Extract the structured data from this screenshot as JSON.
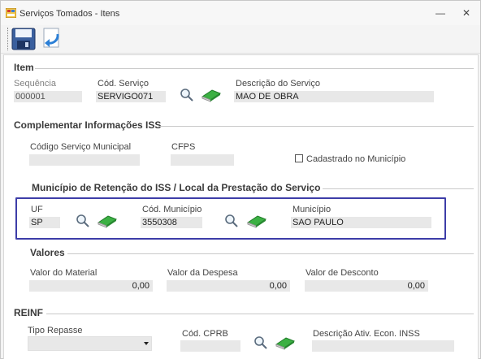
{
  "window": {
    "title": "Serviços Tomados - Itens",
    "minimize": "—",
    "close": "✕"
  },
  "toolbar": {
    "save_icon": "save-icon",
    "undo_icon": "undo-icon"
  },
  "item": {
    "section_title": "Item",
    "sequencia_label": "Sequência",
    "sequencia_value": "000001",
    "cod_servico_label": "Cód. Serviço",
    "cod_servico_value": "SERVIGO071",
    "descricao_label": "Descrição do Serviço",
    "descricao_value": "MAO DE OBRA"
  },
  "complementar": {
    "section_title": "Complementar Informações ISS",
    "codigo_municipal_label": "Código Serviço Municipal",
    "codigo_municipal_value": "",
    "cfps_label": "CFPS",
    "cfps_value": "",
    "cadastrado_label": "Cadastrado no Município"
  },
  "retencao": {
    "section_title": "Município de Retenção do ISS / Local da Prestação  do Serviço",
    "uf_label": "UF",
    "uf_value": "SP",
    "cod_municipio_label": "Cód. Município",
    "cod_municipio_value": "3550308",
    "municipio_label": "Município",
    "municipio_value": "SAO PAULO"
  },
  "valores": {
    "section_title": "Valores",
    "material_label": "Valor do Material",
    "material_value": "0,00",
    "despesa_label": "Valor da Despesa",
    "despesa_value": "0,00",
    "desconto_label": "Valor de Desconto",
    "desconto_value": "0,00"
  },
  "reinf": {
    "section_title": "REINF",
    "tipo_repasse_label": "Tipo Repasse",
    "tipo_repasse_value": "",
    "cod_cprb_label": "Cód. CPRB",
    "cod_cprb_value": "",
    "descricao_ativ_label": "Descrição Ativ. Econ. INSS",
    "descricao_ativ_value": ""
  },
  "colors": {
    "highlight_border": "#3d3da8",
    "field_bg": "#e8e8e8",
    "eraser_green": "#3cb043"
  }
}
